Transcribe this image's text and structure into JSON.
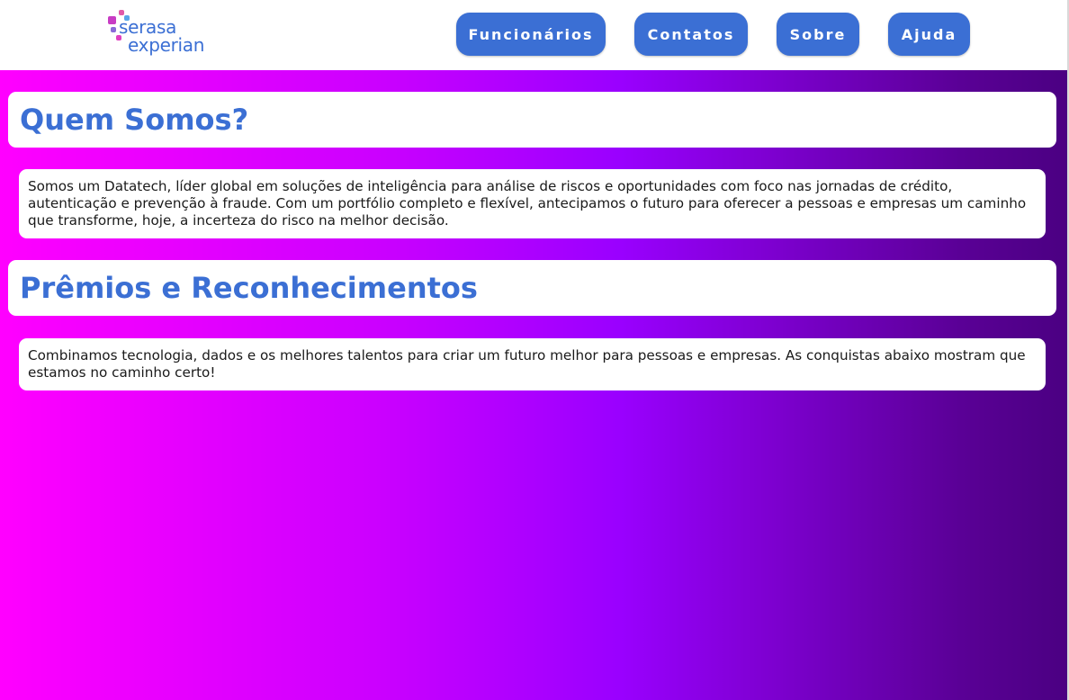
{
  "logo": {
    "line1": "serasa",
    "line2": "experian",
    "dot_colors": [
      "#c83cc4",
      "#d84bb8",
      "#58a6e8",
      "#8a6ad8",
      "#e05aa8"
    ]
  },
  "nav": {
    "items": [
      {
        "label": "Funcionários"
      },
      {
        "label": "Contatos"
      },
      {
        "label": "Sobre"
      },
      {
        "label": "Ajuda"
      }
    ]
  },
  "sections": [
    {
      "heading": "Quem Somos?",
      "text": "Somos um Datatech, líder global em soluções de inteligência para análise de riscos e oportunidades com foco nas jornadas de crédito, autenticação e prevenção à fraude. Com um portfólio completo e flexível, antecipamos o futuro para oferecer a pessoas e empresas um caminho que transforme, hoje, a incerteza do risco na melhor decisão."
    },
    {
      "heading": "Prêmios e Reconhecimentos",
      "text": "Combinamos tecnologia, dados e os melhores talentos para criar um futuro melhor para pessoas e empresas. As conquistas abaixo mostram que estamos no caminho certo!"
    }
  ],
  "colors": {
    "accent": "#3b6fd4",
    "gradient_start": "#ff00ff",
    "gradient_end": "#4b0082"
  }
}
